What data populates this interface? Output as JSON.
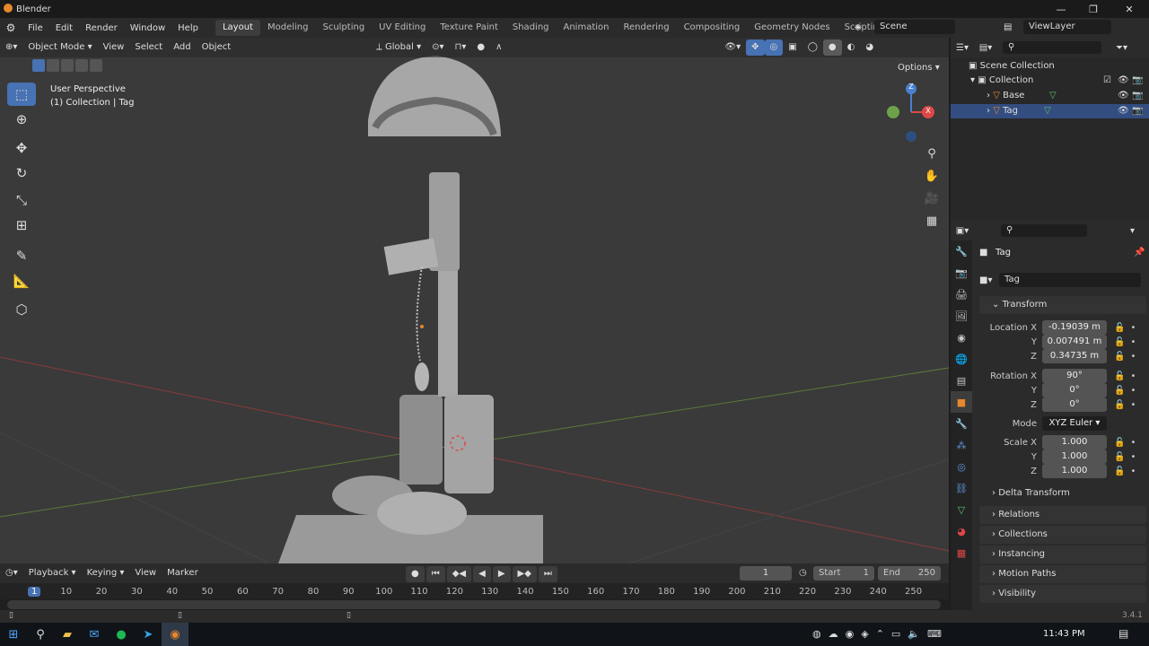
{
  "app": {
    "title": "Blender",
    "version": "3.4.1"
  },
  "menus": [
    "File",
    "Edit",
    "Render",
    "Window",
    "Help"
  ],
  "workspaces": [
    "Layout",
    "Modeling",
    "Sculpting",
    "UV Editing",
    "Texture Paint",
    "Shading",
    "Animation",
    "Rendering",
    "Compositing",
    "Geometry Nodes",
    "Scripting"
  ],
  "scene": {
    "label": "Scene",
    "viewlayer": "ViewLayer"
  },
  "viewport": {
    "mode": "Object Mode",
    "menus": [
      "View",
      "Select",
      "Add",
      "Object"
    ],
    "transform_orientation": "Global",
    "options": "Options",
    "overlay_title": "User Perspective",
    "overlay_sub": "(1) Collection | Tag",
    "gizmo": {
      "z": "Z",
      "x": "X"
    }
  },
  "outliner": {
    "search_placeholder": "",
    "root": "Scene Collection",
    "collection": "Collection",
    "items": [
      "Base",
      "Tag"
    ]
  },
  "properties": {
    "object_name": "Tag",
    "data_name": "Tag",
    "transform_label": "Transform",
    "location_label": "Location X",
    "rotation_label": "Rotation X",
    "scale_label": "Scale X",
    "y": "Y",
    "z": "Z",
    "location": [
      "-0.19039 m",
      "0.007491 m",
      "0.34735 m"
    ],
    "rotation": [
      "90°",
      "0°",
      "0°"
    ],
    "mode_label": "Mode",
    "mode_value": "XYZ Euler",
    "scale": [
      "1.000",
      "1.000",
      "1.000"
    ],
    "delta": "Delta Transform",
    "sections": [
      "Relations",
      "Collections",
      "Instancing",
      "Motion Paths",
      "Visibility"
    ]
  },
  "timeline": {
    "menus": [
      "Playback",
      "Keying",
      "View",
      "Marker"
    ],
    "current_frame": "1",
    "start_label": "Start",
    "start": "1",
    "end_label": "End",
    "end": "250",
    "ruler": [
      "1",
      "10",
      "20",
      "30",
      "40",
      "50",
      "60",
      "70",
      "80",
      "90",
      "100",
      "110",
      "120",
      "130",
      "140",
      "150",
      "160",
      "170",
      "180",
      "190",
      "200",
      "210",
      "220",
      "230",
      "240",
      "250"
    ]
  },
  "taskbar": {
    "time": "11:43 PM"
  },
  "colors": {
    "accent": "#4772b3",
    "orange": "#e8872b",
    "red_axis": "#e04848",
    "green_axis": "#6ea24a",
    "blue_axis": "#4a80d0"
  }
}
